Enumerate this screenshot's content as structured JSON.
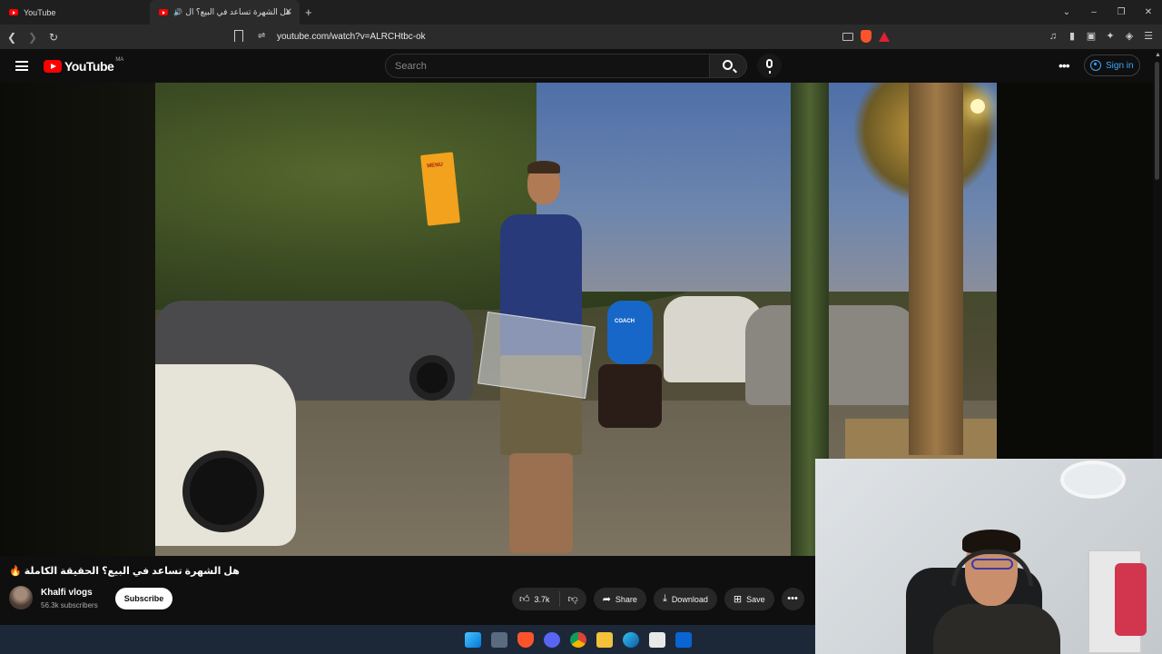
{
  "browser": {
    "tabs": [
      {
        "label": "YouTube",
        "active": false
      },
      {
        "label": "هل الشهرة تساعد في البيع؟ ال",
        "active": true
      }
    ],
    "new_tab": "+",
    "url": "youtube.com/watch?v=ALRCHtbc-ok",
    "window_controls": [
      "⌄",
      "–",
      "❐",
      "✕"
    ]
  },
  "youtube": {
    "logo_text": "YouTube",
    "country_code": "MA",
    "search_placeholder": "Search",
    "more_label": "•••",
    "sign_in_label": "Sign in"
  },
  "video_overlay_text": {
    "menu_card": "MENU",
    "courier_jacket": "COACH"
  },
  "video": {
    "title": "هل الشهرة تساعد في البيع؟ الحقيقة الكاملة 🔥",
    "channel_name": "Khalfi vlogs",
    "subscribers": "56.3k subscribers",
    "subscribe_label": "Subscribe",
    "like_count": "3.7k",
    "share_label": "Share",
    "download_label": "Download",
    "save_label": "Save",
    "more_label": "•••"
  },
  "taskbar": {
    "icons": [
      "windows-start-icon",
      "task-view-icon",
      "brave-browser-icon",
      "discord-icon",
      "chrome-icon",
      "file-explorer-icon",
      "edge-icon",
      "store-icon",
      "outlook-icon"
    ]
  },
  "colors": {
    "yt_red": "#ff0000",
    "link_blue": "#3ea6ff",
    "background": "#0f0f0f",
    "taskbar": "#1c2838"
  }
}
